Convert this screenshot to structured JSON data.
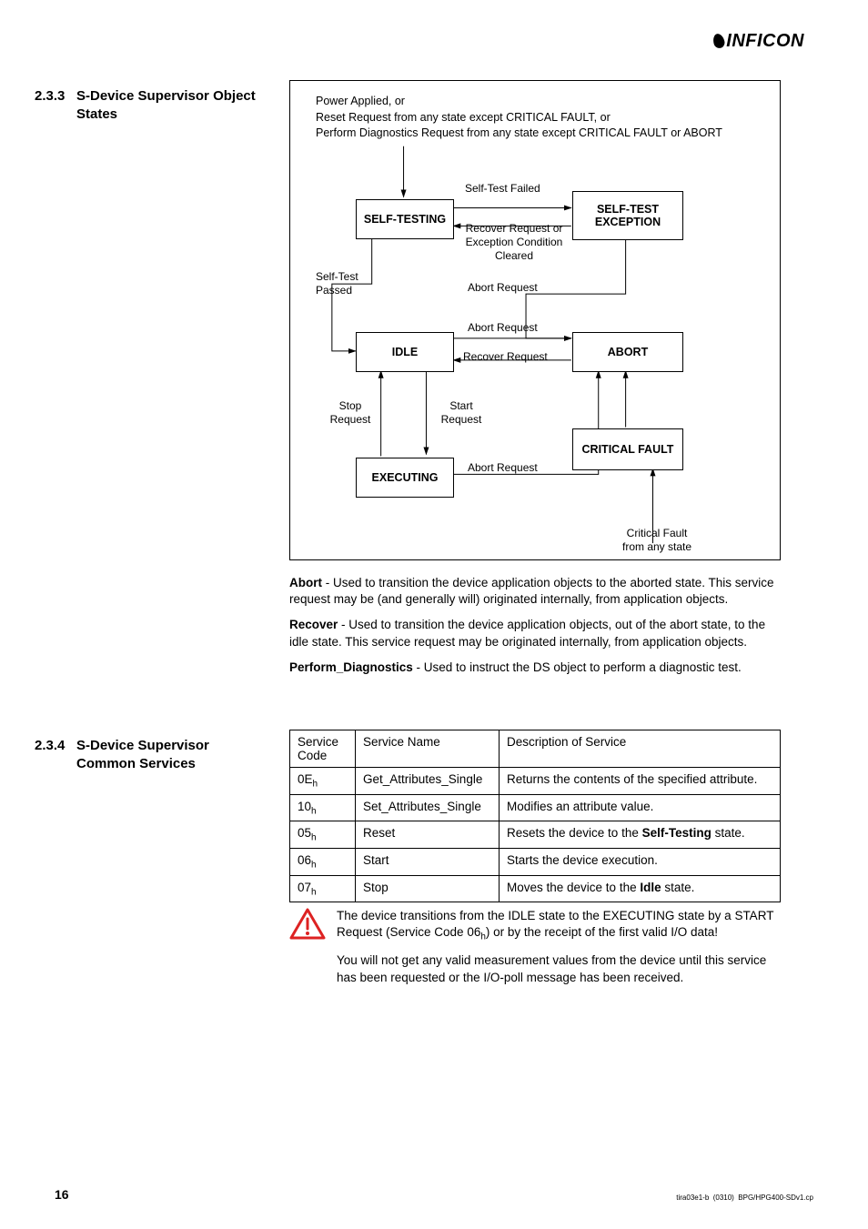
{
  "logo": "INFICON",
  "sections": {
    "s233": {
      "num": "2.3.3",
      "title": "S-Device Supervisor Object States"
    },
    "s234": {
      "num": "2.3.4",
      "title": "S-Device Supervisor Common Services"
    }
  },
  "diagram": {
    "top_text_line1": "Power Applied, or",
    "top_text_line2": "Reset Request from any state except CRITICAL FAULT, or",
    "top_text_line3": "Perform Diagnostics Request from any state except CRITICAL FAULT or ABORT",
    "states": {
      "self_testing": "SELF-TESTING",
      "self_test_exception": "SELF-TEST EXCEPTION",
      "idle": "IDLE",
      "abort": "ABORT",
      "executing": "EXECUTING",
      "critical_fault": "CRITICAL FAULT"
    },
    "labels": {
      "self_test_failed": "Self-Test Failed",
      "recover_or_cleared": "Recover Request or Exception Condition Cleared",
      "self_test_passed": "Self-Test Passed",
      "abort_request1": "Abort Request",
      "abort_request2": "Abort Request",
      "recover_request": "Recover Request",
      "stop_request": "Stop Request",
      "start_request": "Start Request",
      "abort_request3": "Abort Request",
      "critical_from_any": "Critical Fault from any state"
    }
  },
  "definitions": {
    "abort_label": "Abort",
    "abort_text": " - Used to transition the device application objects to the aborted state. This service request may be (and generally will) originated internally, from application objects.",
    "recover_label": "Recover",
    "recover_text": " - Used to transition the device application objects, out of the abort state, to the idle state. This service request may be originated internally, from application objects.",
    "perform_label": "Perform_Diagnostics",
    "perform_text": " - Used to instruct the DS object to perform a diagnostic test."
  },
  "services_table": {
    "headers": {
      "code": "Service Code",
      "name": "Service Name",
      "desc": "Description of Service"
    },
    "rows": [
      {
        "code_num": "0E",
        "code_sub": "h",
        "name": "Get_Attributes_Single",
        "desc_pre": "Returns the contents of the specified attribute.",
        "bold": "",
        "desc_post": ""
      },
      {
        "code_num": "10",
        "code_sub": "h",
        "name": "Set_Attributes_Single",
        "desc_pre": "Modifies an attribute value.",
        "bold": "",
        "desc_post": ""
      },
      {
        "code_num": "05",
        "code_sub": "h",
        "name": "Reset",
        "desc_pre": "Resets the device to the ",
        "bold": "Self-Testing",
        "desc_post": " state."
      },
      {
        "code_num": "06",
        "code_sub": "h",
        "name": "Start",
        "desc_pre": "Starts the device execution.",
        "bold": "",
        "desc_post": ""
      },
      {
        "code_num": "07",
        "code_sub": "h",
        "name": "Stop",
        "desc_pre": "Moves the device to the ",
        "bold": "Idle",
        "desc_post": " state."
      }
    ]
  },
  "warning": {
    "p1_pre": "The device transitions from the IDLE state to the EXECUTING state by a START Request (Service Code 06",
    "p1_sub": "h",
    "p1_post": ") or by the receipt of the first valid I/O data!",
    "p2": "You will not get any valid measurement values from the device until this service has been requested or the I/O-poll message has been received."
  },
  "footer": {
    "page_number": "16",
    "doc_id": "tira03e1-b  (0310)  BPG/HPG400-SDv1.cp"
  }
}
